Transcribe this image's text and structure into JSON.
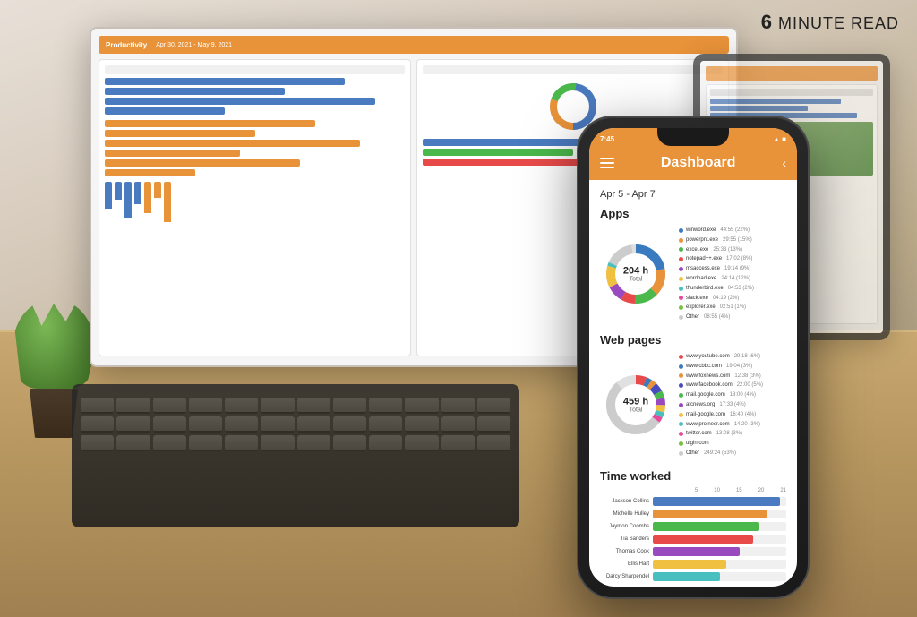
{
  "read_badge": {
    "number": "6",
    "text": "MINUTE READ"
  },
  "phone": {
    "status_bar": {
      "time": "7:45",
      "wifi": "▲",
      "battery": "■"
    },
    "header": {
      "title": "Dashboard",
      "menu_icon": "hamburger",
      "back_icon": "chevron"
    },
    "date_range": "Apr 5 - Apr 7",
    "apps_section": {
      "title": "Apps",
      "total": "204 h",
      "total_label": "Total",
      "legend": [
        {
          "label": "winword.exe",
          "color": "#3a7abf",
          "value": "44:55 (22%)"
        },
        {
          "label": "powerpnt.exe",
          "color": "#e8923a",
          "value": "29:55 (15%)"
        },
        {
          "label": "excel.exe",
          "color": "#4ab84a",
          "value": "25:33 (13%)"
        },
        {
          "label": "notepad++.exe",
          "color": "#e84a4a",
          "value": "17:02 (8%)"
        },
        {
          "label": "msaccess.exe",
          "color": "#9a4abf",
          "value": "19:14 (9%)"
        },
        {
          "label": "wordpad.exe",
          "color": "#f0c040",
          "value": "24:14 (12%)"
        },
        {
          "label": "thunderbird.exe",
          "color": "#4abfbf",
          "value": "04:53 (2%)"
        },
        {
          "label": "slack.exe",
          "color": "#e84a9a",
          "value": "04:19 (2%)"
        },
        {
          "label": "explorer.exe",
          "color": "#7abf40",
          "value": "02:51 (1%)"
        },
        {
          "label": "Other",
          "color": "#cccccc",
          "value": "08:55 (4%)"
        }
      ],
      "donut_segments": [
        {
          "color": "#3a7abf",
          "percent": 22
        },
        {
          "color": "#e8923a",
          "percent": 15
        },
        {
          "color": "#4ab84a",
          "percent": 13
        },
        {
          "color": "#e84a4a",
          "percent": 8
        },
        {
          "color": "#9a4abf",
          "percent": 9
        },
        {
          "color": "#f0c040",
          "percent": 12
        },
        {
          "color": "#4abfbf",
          "percent": 2
        },
        {
          "color": "#e84a9a",
          "percent": 2
        },
        {
          "color": "#7abf40",
          "percent": 1
        },
        {
          "color": "#cccccc",
          "percent": 16
        }
      ]
    },
    "web_section": {
      "title": "Web pages",
      "total": "459 h",
      "total_label": "Total",
      "legend": [
        {
          "label": "www.youtube.com",
          "color": "#e84a4a",
          "value": "29:18 (6%)"
        },
        {
          "label": "www.cbbc.com",
          "color": "#3a7abf",
          "value": "19:04 (3%)"
        },
        {
          "label": "www.foxnews.com",
          "color": "#e8923a",
          "value": "12:38 (3%)"
        },
        {
          "label": "www.facebook.com",
          "color": "#4a4abf",
          "value": "22:00 (5%)"
        },
        {
          "label": "mail.google.com",
          "color": "#4ab84a",
          "value": "18:00 (4%)"
        },
        {
          "label": "afcnews.org",
          "color": "#9a4abf",
          "value": "17:33 (4%)"
        },
        {
          "label": "mail-google.com",
          "color": "#f0c040",
          "value": "16:40 (4%)"
        },
        {
          "label": "www.proinesr.com",
          "color": "#4abfbf",
          "value": "14:20 (3%)"
        },
        {
          "label": "twitter.com",
          "color": "#e84a9a",
          "value": "13:08 (3%)"
        },
        {
          "label": "uigin.com",
          "color": "#7abf40",
          "value": ""
        },
        {
          "label": "Other",
          "color": "#cccccc",
          "value": "249:24 (53%)"
        }
      ]
    },
    "time_worked": {
      "title": "Time worked",
      "axis_labels": [
        "5",
        "10",
        "15",
        "20",
        "21"
      ],
      "workers": [
        {
          "name": "Jackson Collins",
          "value": 95,
          "color": "#4a7abf"
        },
        {
          "name": "Michelle Hulley",
          "value": 85,
          "color": "#e8923a"
        },
        {
          "name": "Jaymon Coombs",
          "value": 80,
          "color": "#4ab84a"
        },
        {
          "name": "Tia Sanders",
          "value": 75,
          "color": "#e84a4a"
        },
        {
          "name": "Thomas Cook",
          "value": 65,
          "color": "#9a4abf"
        },
        {
          "name": "Ellis Hart",
          "value": 55,
          "color": "#f0c040"
        },
        {
          "name": "Darcy Sharpendel",
          "value": 50,
          "color": "#4abfbf"
        }
      ]
    }
  },
  "laptop": {
    "title": "Productivity",
    "date_range": "Apr 30, 2021 - May 9, 2021"
  }
}
